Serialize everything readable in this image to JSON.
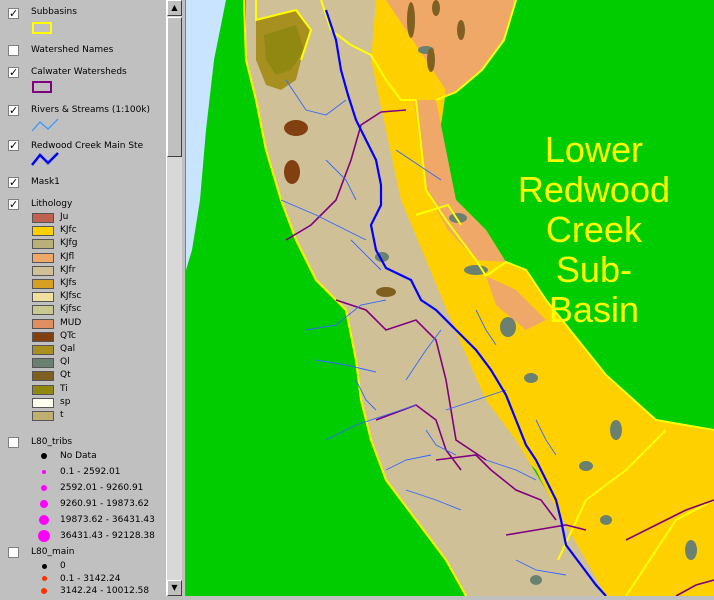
{
  "toc": {
    "layers": [
      {
        "label": "Subbasins",
        "checked": true
      },
      {
        "label": "Watershed Names",
        "checked": false
      },
      {
        "label": "Calwater Watersheds",
        "checked": true
      },
      {
        "label": "Rivers & Streams (1:100k)",
        "checked": true
      },
      {
        "label": "Redwood Creek Main Ste",
        "checked": true
      },
      {
        "label": "Mask1",
        "checked": true
      },
      {
        "label": "Lithology",
        "checked": true
      },
      {
        "label": "L80_tribs",
        "checked": false
      },
      {
        "label": "L80_main",
        "checked": false
      }
    ],
    "lithology_classes": [
      {
        "label": "Ju",
        "color": "#c06050"
      },
      {
        "label": "KJfc",
        "color": "#ffd000"
      },
      {
        "label": "KJfg",
        "color": "#b8b078"
      },
      {
        "label": "KJfl",
        "color": "#f0a868"
      },
      {
        "label": "KJfr",
        "color": "#d0c098"
      },
      {
        "label": "KJfs",
        "color": "#d8a020"
      },
      {
        "label": "KJfsc",
        "color": "#f0e0a0"
      },
      {
        "label": "Kjfsc",
        "color": "#c8c890"
      },
      {
        "label": "MUD",
        "color": "#e09060"
      },
      {
        "label": "QTc",
        "color": "#804010"
      },
      {
        "label": "Qal",
        "color": "#a89020"
      },
      {
        "label": "Ql",
        "color": "#6a8070"
      },
      {
        "label": "Qt",
        "color": "#806020"
      },
      {
        "label": "Ti",
        "color": "#908810"
      },
      {
        "label": "sp",
        "color": "#fffff0"
      },
      {
        "label": "t",
        "color": "#c0b070"
      }
    ],
    "tribs_classes": [
      {
        "label": "No Data",
        "color": "#000000",
        "size": 6
      },
      {
        "label": "0.1 - 2592.01",
        "color": "#ff00ff",
        "size": 4
      },
      {
        "label": "2592.01 - 9260.91",
        "color": "#ff00ff",
        "size": 6
      },
      {
        "label": "9260.91 - 19873.62",
        "color": "#ff00ff",
        "size": 8
      },
      {
        "label": "19873.62 - 36431.43",
        "color": "#ff00ff",
        "size": 10
      },
      {
        "label": "36431.43 - 92128.38",
        "color": "#ff00ff",
        "size": 12
      }
    ],
    "main_classes": [
      {
        "label": "0",
        "color": "#000000",
        "size": 5
      },
      {
        "label": "0.1 - 3142.24",
        "color": "#ff3000",
        "size": 5
      },
      {
        "label": "3142.24 - 10012.58",
        "color": "#ff3000",
        "size": 6
      }
    ]
  },
  "map": {
    "label_lines": [
      "Lower",
      "Redwood",
      "Creek",
      "Sub-",
      "Basin"
    ],
    "colors": {
      "mask": "#00cc00",
      "water": "#c8e4ff",
      "subbasin": "#ffff00",
      "watershed": "#800080",
      "stream": "#3366ff",
      "main_stem": "#0000ff"
    }
  }
}
